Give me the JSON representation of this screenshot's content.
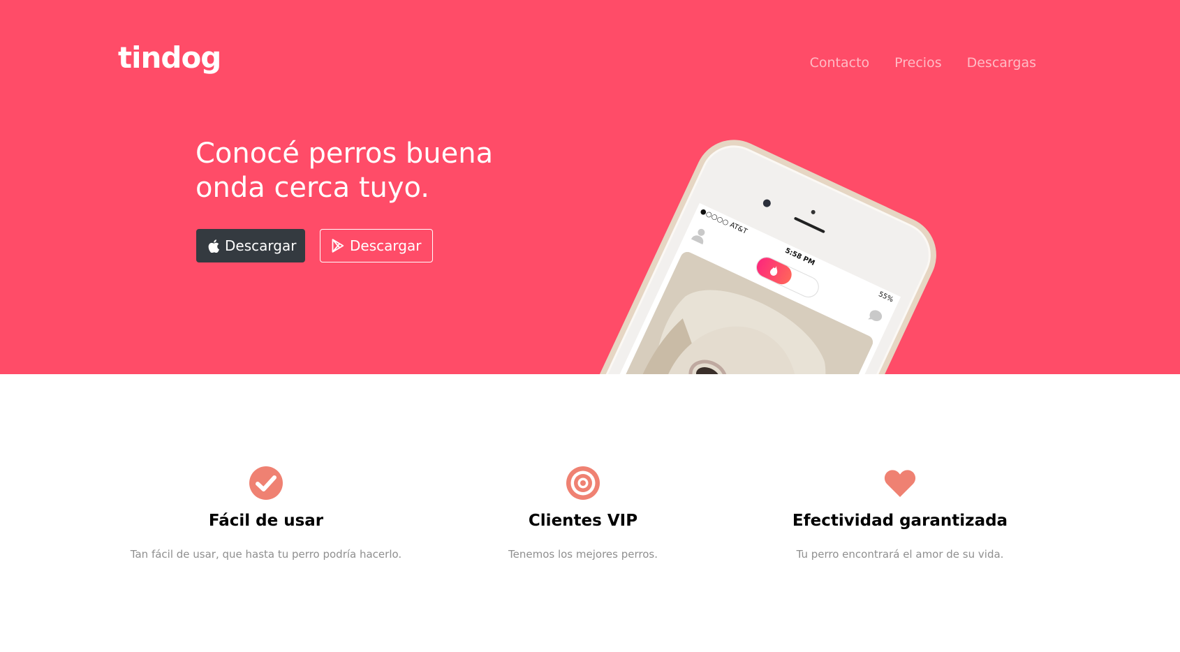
{
  "brand": {
    "name": "tindog"
  },
  "nav": {
    "items": [
      {
        "label": "Contacto"
      },
      {
        "label": "Precios"
      },
      {
        "label": "Descargas"
      }
    ]
  },
  "hero": {
    "headline_line1": "Conocé perros buena",
    "headline_line2": "onda cerca tuyo.",
    "buttons": [
      {
        "label": "Descargar",
        "icon": "apple-icon"
      },
      {
        "label": "Descargar",
        "icon": "google-play-icon"
      }
    ],
    "phone": {
      "carrier": "●○○○○ AT&T",
      "time": "5:58 PM",
      "battery": "55%"
    }
  },
  "features": [
    {
      "icon": "check-circle-icon",
      "title": "Fácil de usar",
      "description": "Tan fácil de usar, que hasta tu perro podría hacerlo."
    },
    {
      "icon": "bullseye-icon",
      "title": "Clientes VIP",
      "description": "Tenemos los mejores perros."
    },
    {
      "icon": "heart-icon",
      "title": "Efectividad garantizada",
      "description": "Tu perro encontrará el amor de su vida."
    }
  ],
  "colors": {
    "hero_background": "#ff4c68",
    "feature_icon": "#ef8172",
    "dark_button": "#343a40"
  }
}
